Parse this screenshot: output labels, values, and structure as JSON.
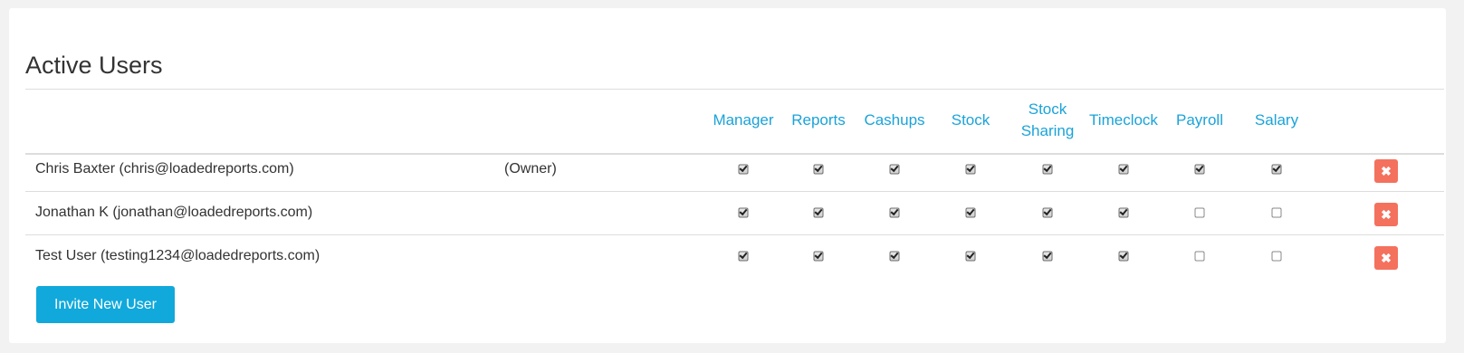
{
  "section": {
    "title": "Active Users"
  },
  "columns": [
    {
      "key": "manager",
      "label": "Manager"
    },
    {
      "key": "reports",
      "label": "Reports"
    },
    {
      "key": "cashups",
      "label": "Cashups"
    },
    {
      "key": "stock",
      "label": "Stock"
    },
    {
      "key": "stock_sharing",
      "label": "Stock\nSharing"
    },
    {
      "key": "timeclock",
      "label": "Timeclock"
    },
    {
      "key": "payroll",
      "label": "Payroll"
    },
    {
      "key": "salary",
      "label": "Salary"
    }
  ],
  "users": [
    {
      "name": "Chris Baxter (chris@loadedreports.com)",
      "role": "(Owner)",
      "permissions": [
        true,
        true,
        true,
        true,
        true,
        true,
        true,
        true
      ]
    },
    {
      "name": "Jonathan K (jonathan@loadedreports.com)",
      "role": "",
      "permissions": [
        true,
        true,
        true,
        true,
        true,
        true,
        false,
        false
      ]
    },
    {
      "name": "Test User (testing1234@loadedreports.com)",
      "role": "",
      "permissions": [
        true,
        true,
        true,
        true,
        true,
        true,
        false,
        false
      ]
    }
  ],
  "delete_icon": "close-icon",
  "delete_glyph": "✖",
  "invite_button": {
    "label": "Invite New User"
  },
  "colors": {
    "accent": "#11a9dc",
    "danger": "#f4715e",
    "header_text": "#1aa3d9"
  }
}
